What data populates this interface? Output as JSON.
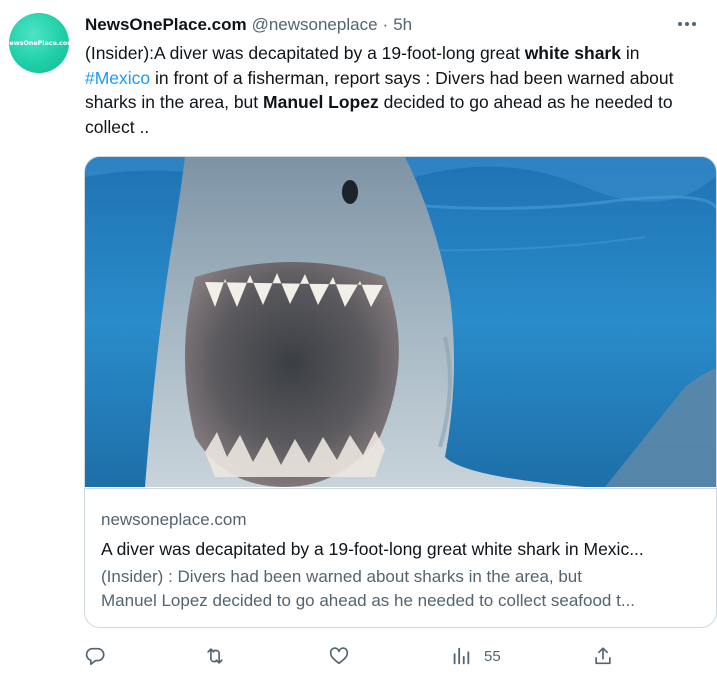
{
  "author": {
    "avatar_text": "NewsOnePlace.com",
    "display_name": "NewsOnePlace.com",
    "handle": "@newsoneplace",
    "separator": "·",
    "time": "5h"
  },
  "tweet": {
    "p1": "(Insider):A diver was decapitated by a 19-foot-long great ",
    "b1": "white shark",
    "p2": " in ",
    "hashtag": "#Mexico",
    "p3": " in front of a fisherman, report says : Divers had been warned about sharks in the area, but ",
    "b2": "Manuel Lopez",
    "p4": " decided to go ahead as he needed to collect .."
  },
  "card": {
    "domain": "newsoneplace.com",
    "title": "A diver was decapitated by a 19-foot-long great white shark in Mexic...",
    "desc_line1": "(Insider) : Divers had been warned about sharks in the area, but",
    "desc_line2": "Manuel Lopez decided to go ahead as he needed to collect seafood t..."
  },
  "actions": {
    "reply_icon": "reply-icon",
    "retweet_icon": "retweet-icon",
    "like_icon": "heart-icon",
    "views_icon": "views-icon",
    "views_count": "55",
    "share_icon": "share-icon"
  },
  "colors": {
    "accent": "#1d9bf0",
    "secondary_text": "#536471",
    "avatar_bg": "#1fcfa8"
  }
}
